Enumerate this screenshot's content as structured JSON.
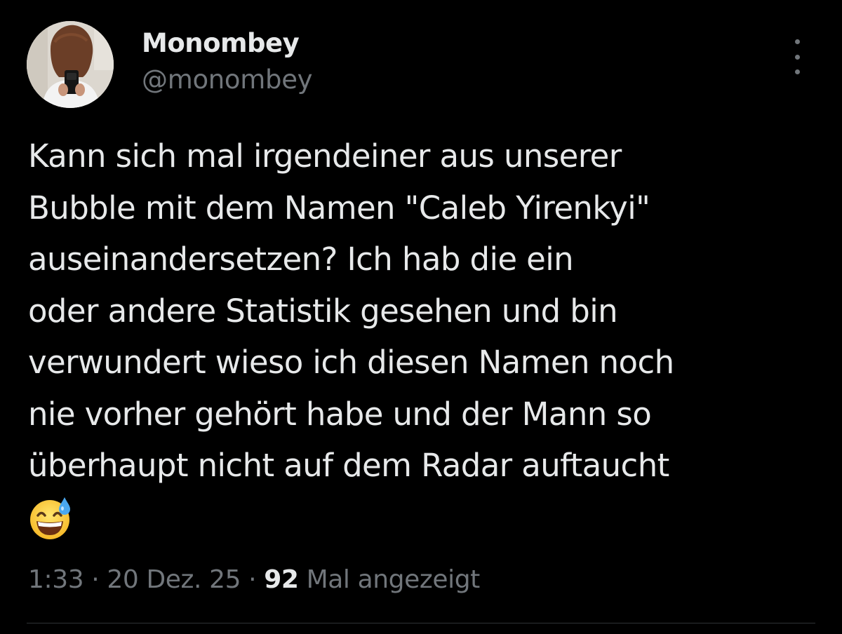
{
  "author": {
    "display_name": "Monombey",
    "handle": "@monombey"
  },
  "tweet": {
    "text": "Kann sich mal irgendeiner aus unserer\nBubble mit dem Namen \"Caleb Yirenkyi\"\nauseinandersetzen? Ich hab die ein\noder andere Statistik gesehen und bin\nverwundert wieso ich diesen Namen noch\nnie vorher gehört habe und der Mann so\nüberhaupt nicht auf dem Radar auftaucht",
    "emoji": "grinning-face-with-sweat"
  },
  "meta": {
    "time": "1:33",
    "separator": "·",
    "date": "20 Dez. 25",
    "views_count": "92",
    "views_label": "Mal angezeigt"
  },
  "icons": {
    "more": "more-vertical-icon"
  },
  "colors": {
    "background": "#000000",
    "primary_text": "#e7e9ea",
    "secondary_text": "#71767b",
    "divider": "#2f3336"
  }
}
